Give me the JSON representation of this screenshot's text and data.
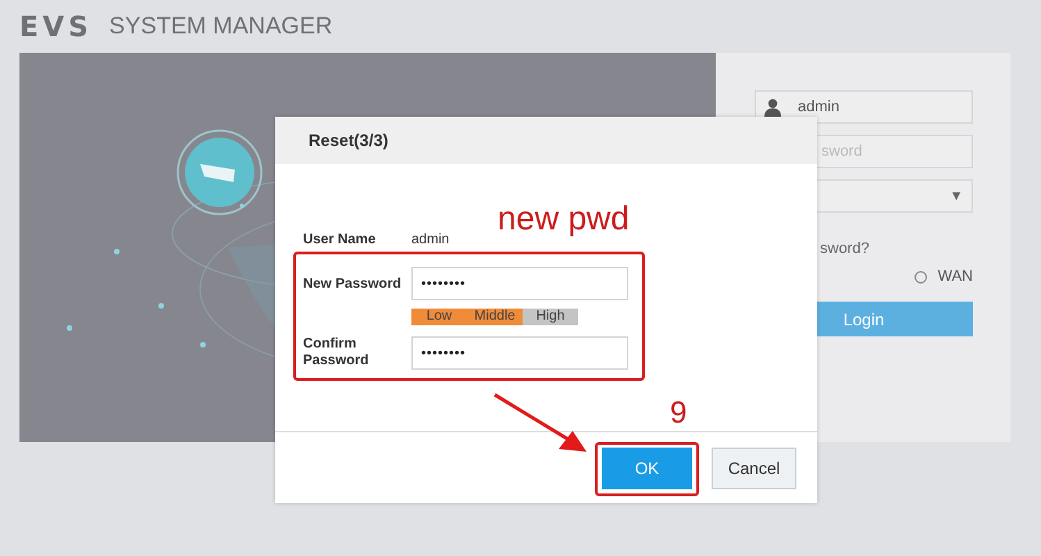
{
  "header": {
    "logo": "EVS",
    "title": "SYSTEM MANAGER"
  },
  "login": {
    "username": "admin",
    "password_placeholder": "sword",
    "select_arrow": "▼",
    "forgot": "sword?",
    "radio": {
      "label": "WAN",
      "selected": false
    },
    "button": "Login"
  },
  "dialog": {
    "title": "Reset(3/3)",
    "user_name": {
      "label": "User Name",
      "value": "admin"
    },
    "new_password": {
      "label": "New Password",
      "value": "••••••••"
    },
    "strength": [
      {
        "label": "Low",
        "on": true
      },
      {
        "label": "Middle",
        "on": true
      },
      {
        "label": "High",
        "on": false
      }
    ],
    "confirm_password": {
      "label": "Confirm Password",
      "value": "••••••••"
    },
    "buttons": [
      {
        "label": "OK",
        "kind": "primary"
      },
      {
        "label": "Cancel",
        "kind": "secondary"
      }
    ]
  },
  "annotations": {
    "note": "new pwd",
    "step": "9"
  }
}
